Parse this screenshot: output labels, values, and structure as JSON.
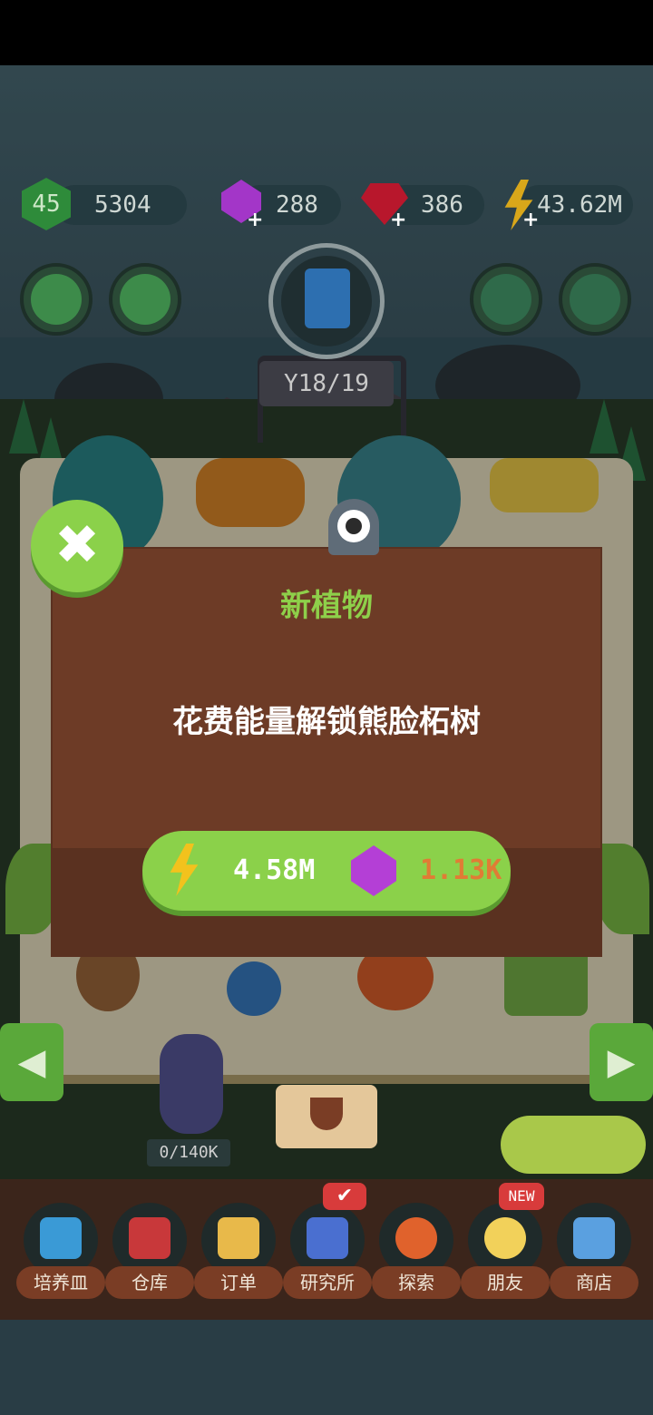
{
  "hud": {
    "level": "45",
    "coins": "5304",
    "gems": "288",
    "rubies": "386",
    "energy": "43.62M"
  },
  "garden": {
    "plant_progress": "18/19",
    "xp_counter": "0/140K"
  },
  "dialog": {
    "title": "新植物",
    "message": "花费能量解锁熊脸柘树",
    "cost_energy": "4.58M",
    "cost_gems": "1.13K"
  },
  "nav": {
    "items": [
      {
        "label": "培养皿",
        "icon": "sprout-icon"
      },
      {
        "label": "仓库",
        "icon": "barn-icon"
      },
      {
        "label": "订单",
        "icon": "scroll-icon"
      },
      {
        "label": "研究所",
        "icon": "lab-icon"
      },
      {
        "label": "探索",
        "icon": "balloon-icon"
      },
      {
        "label": "朋友",
        "icon": "friends-icon"
      },
      {
        "label": "商店",
        "icon": "shop-icon"
      }
    ],
    "new_badge": "NEW",
    "check_badge": "✔"
  },
  "colors": {
    "accent_green": "#8bd14a",
    "dialog_brown": "#6d3b26",
    "title_green": "#8ed04a",
    "gem_cost_orange": "#e07c35"
  }
}
